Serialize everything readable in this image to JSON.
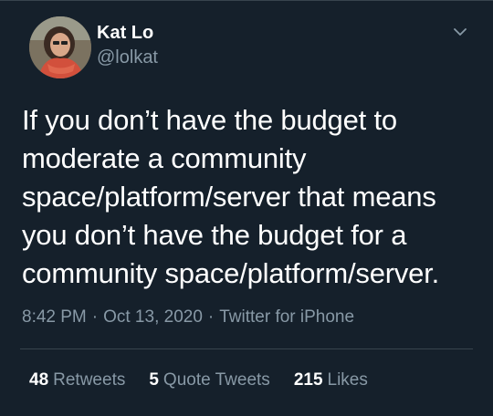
{
  "author": {
    "display_name": "Kat Lo",
    "handle": "@lolkat"
  },
  "tweet": {
    "text": "If you don’t have the budget to\nmoderate a community\nspace/platform/server that means\nyou don’t have the budget for a\ncommunity space/platform/server.",
    "time": "8:42 PM",
    "date": "Oct 13, 2020",
    "source": "Twitter for iPhone"
  },
  "stats": {
    "retweets_count": "48",
    "retweets_label": "Retweets",
    "quotes_count": "5",
    "quotes_label": "Quote Tweets",
    "likes_count": "215",
    "likes_label": "Likes"
  },
  "icons": {
    "menu": "chevron-down-icon",
    "avatar": "avatar"
  },
  "colors": {
    "background": "#15202b",
    "secondary_text": "#8899a6",
    "divider": "#38444d",
    "primary_text": "#ffffff"
  }
}
